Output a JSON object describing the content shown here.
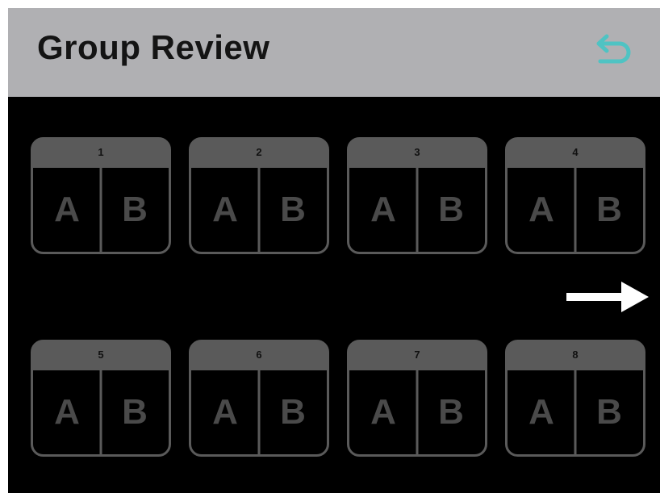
{
  "header": {
    "title": "Group Review",
    "back_icon": "return-arrow-icon",
    "back_icon_color": "#4fc3c3",
    "background": "#b0b0b3"
  },
  "groups": [
    {
      "number": "1",
      "slot_a": "A",
      "slot_b": "B"
    },
    {
      "number": "2",
      "slot_a": "A",
      "slot_b": "B"
    },
    {
      "number": "3",
      "slot_a": "A",
      "slot_b": "B"
    },
    {
      "number": "4",
      "slot_a": "A",
      "slot_b": "B"
    },
    {
      "number": "5",
      "slot_a": "A",
      "slot_b": "B"
    },
    {
      "number": "6",
      "slot_a": "A",
      "slot_b": "B"
    },
    {
      "number": "7",
      "slot_a": "A",
      "slot_b": "B"
    },
    {
      "number": "8",
      "slot_a": "A",
      "slot_b": "B"
    }
  ],
  "navigation": {
    "next_icon": "right-arrow-icon",
    "next_icon_color": "#ffffff"
  },
  "colors": {
    "screen_background": "#000000",
    "card_border": "#5a5a5a",
    "card_header": "#5a5a5a",
    "slot_letter": "#4a4a4a"
  }
}
